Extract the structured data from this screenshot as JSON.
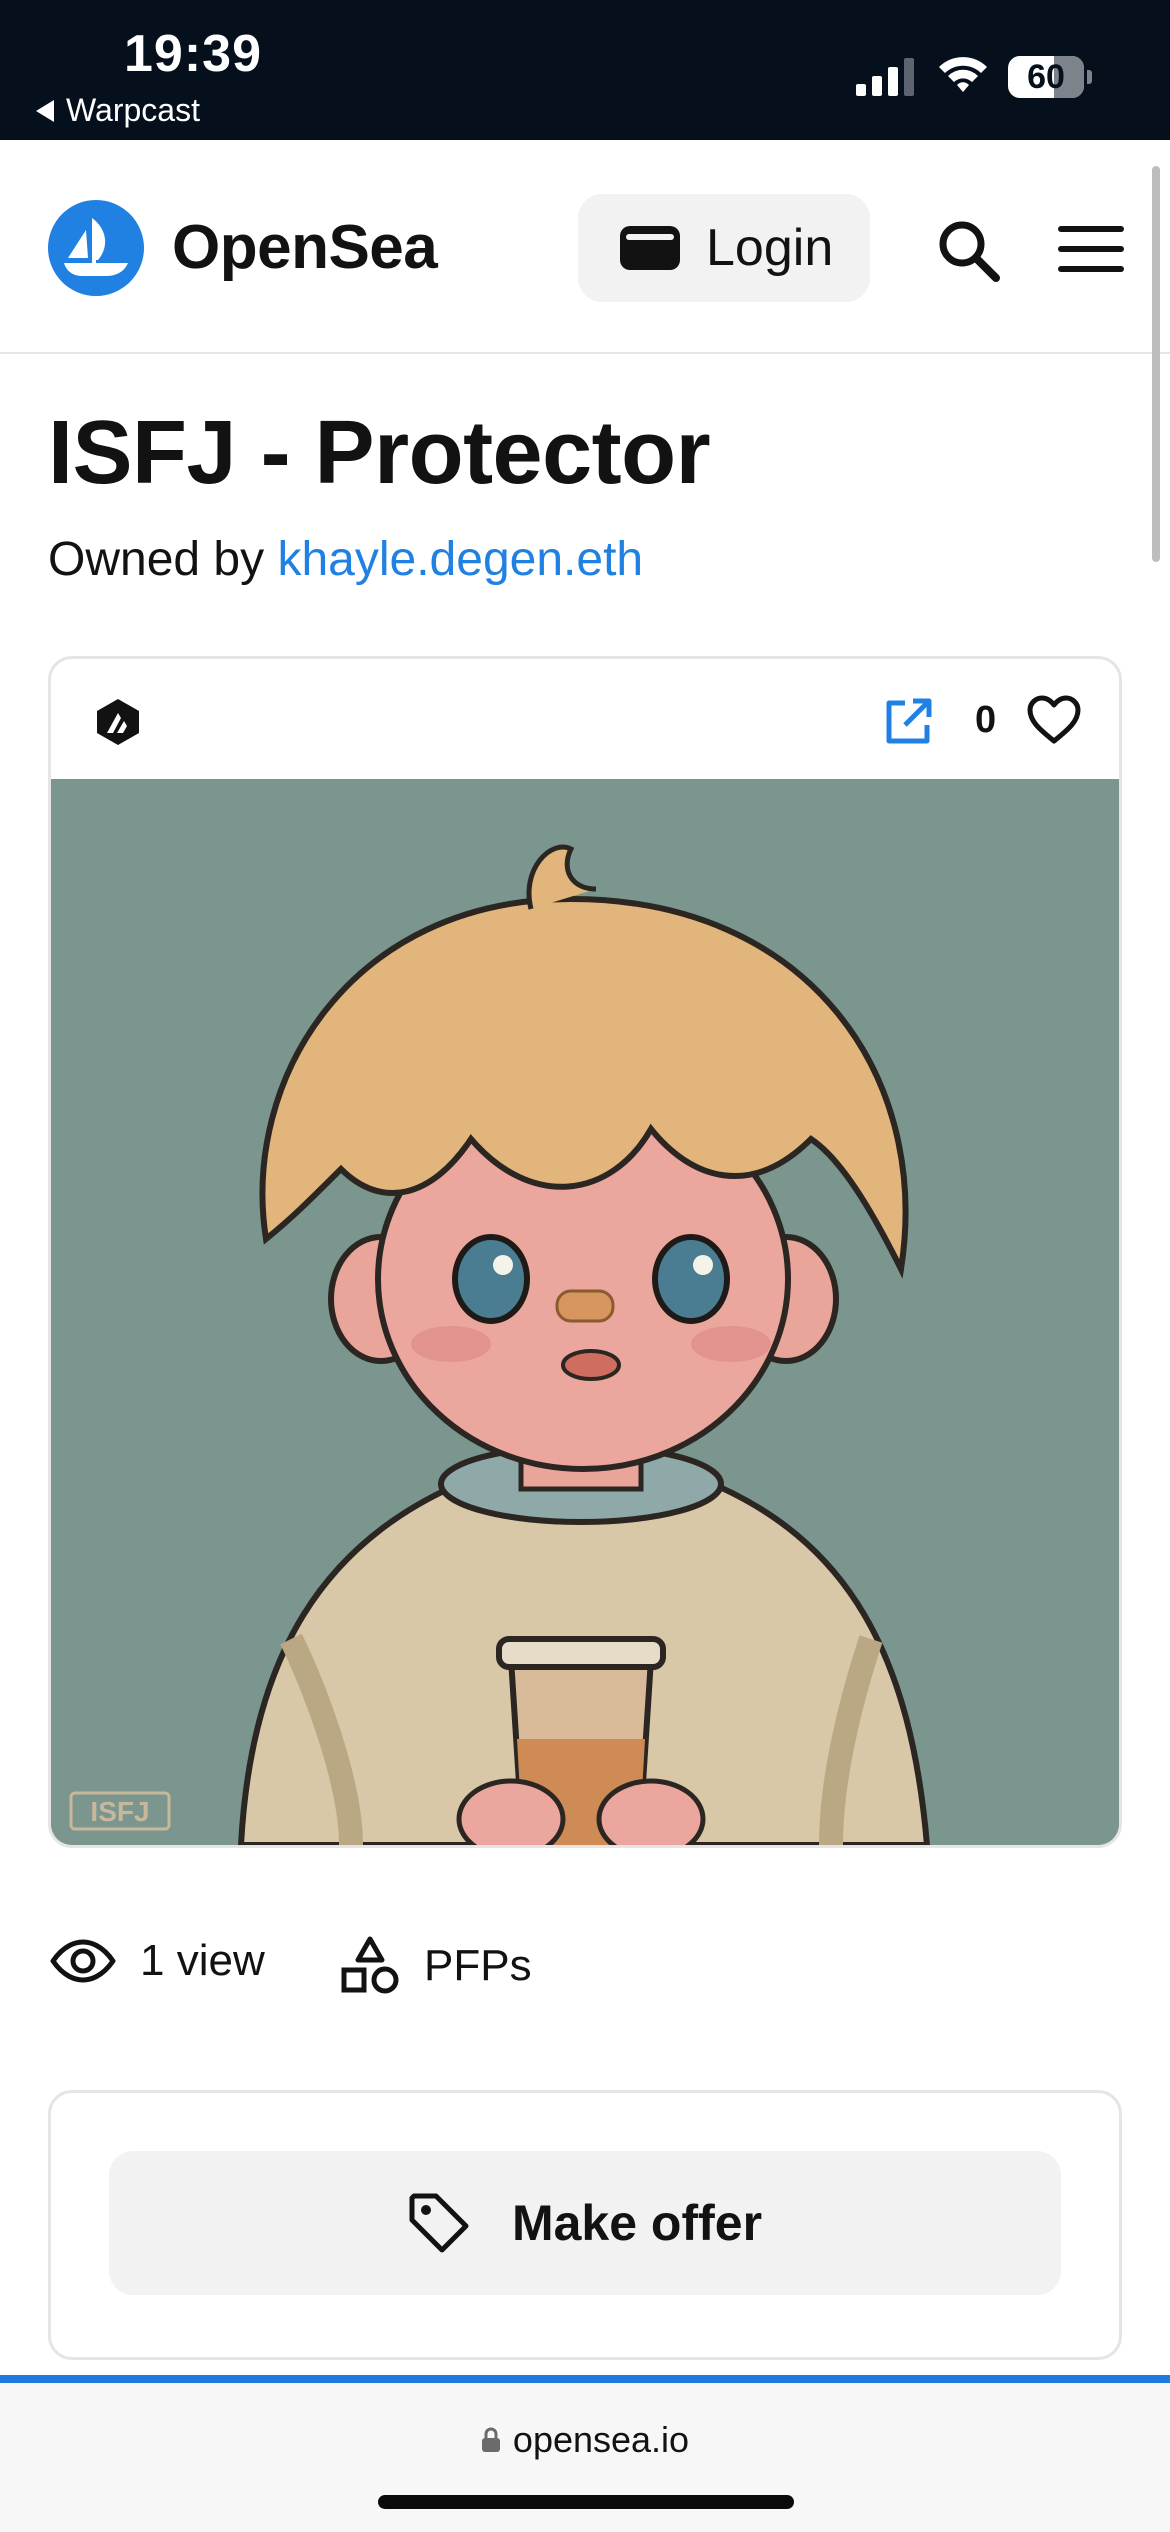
{
  "status_bar": {
    "time": "19:39",
    "back_app": "Warpcast",
    "battery": "60"
  },
  "header": {
    "brand": "OpenSea",
    "login_label": "Login",
    "accent_color": "#2081e2"
  },
  "item": {
    "title": "ISFJ - Protector",
    "owned_by_prefix": "Owned by",
    "owner": "khayle.degen.eth",
    "favorites_count": "0",
    "art_watermark": "ISFJ"
  },
  "stats": {
    "views": "1 view",
    "collection": "PFPs"
  },
  "offer": {
    "button_label": "Make offer"
  },
  "browser": {
    "url": "opensea.io"
  },
  "icons": [
    "back-arrow-icon",
    "signal-icon",
    "wifi-icon",
    "battery-icon",
    "opensea-logo-icon",
    "wallet-icon",
    "search-icon",
    "menu-icon",
    "chain-icon",
    "external-link-icon",
    "heart-icon",
    "eye-icon",
    "shapes-icon",
    "tag-icon",
    "lock-icon"
  ]
}
